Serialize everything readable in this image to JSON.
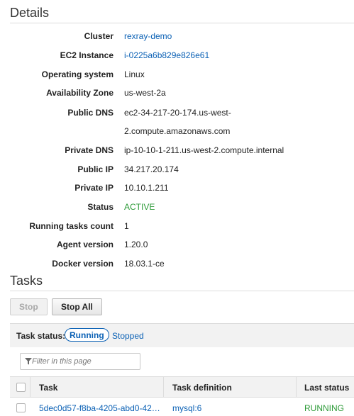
{
  "details": {
    "title": "Details",
    "rows": [
      {
        "label": "Cluster",
        "value": "rexray-demo"
      },
      {
        "label": "EC2 Instance",
        "value": "i-0225a6b829e826e61"
      },
      {
        "label": "Operating system",
        "value": "Linux"
      },
      {
        "label": "Availability Zone",
        "value": "us-west-2a"
      },
      {
        "label": "Public DNS",
        "value": "ec2-34-217-20-174.us-west-",
        "value2": "2.compute.amazonaws.com"
      },
      {
        "label": "Private DNS",
        "value": "ip-10-10-1-211.us-west-2.compute.internal"
      },
      {
        "label": "Public IP",
        "value": "34.217.20.174"
      },
      {
        "label": "Private IP",
        "value": "10.10.1.211"
      },
      {
        "label": "Status",
        "value": "ACTIVE"
      },
      {
        "label": "Running tasks count",
        "value": "1"
      },
      {
        "label": "Agent version",
        "value": "1.20.0"
      },
      {
        "label": "Docker version",
        "value": "18.03.1-ce"
      }
    ]
  },
  "tasks": {
    "title": "Tasks",
    "buttons": {
      "stop": "Stop",
      "stop_all": "Stop All"
    },
    "status_filter": {
      "label": "Task status:",
      "running": "Running",
      "stopped": "Stopped"
    },
    "search": {
      "placeholder": "Filter in this page"
    },
    "columns": [
      "Task",
      "Task definition",
      "Last status"
    ],
    "rows": [
      {
        "task": "5dec0d57-f8ba-4205-abd0-42…",
        "definition": "mysql:6",
        "status": "RUNNING"
      }
    ]
  },
  "colors": {
    "link": "#0b61b5",
    "status_green": "#2d9b38"
  }
}
